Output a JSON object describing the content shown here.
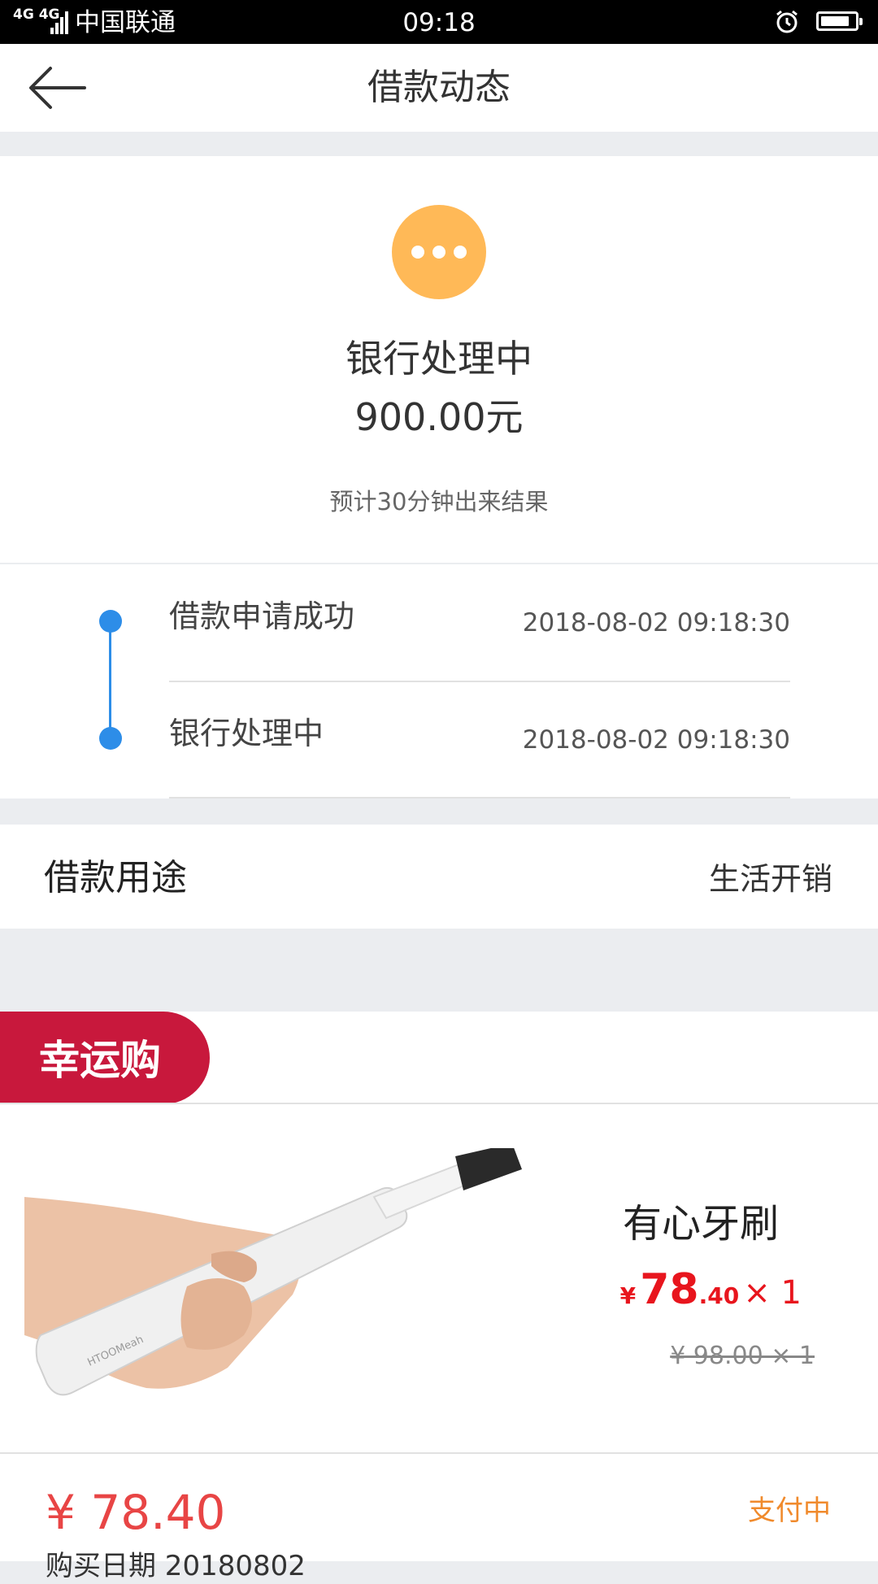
{
  "status_bar": {
    "network": "4G 4G",
    "carrier": "中国联通",
    "time": "09:18",
    "battery_level": 0.85
  },
  "nav": {
    "title": "借款动态"
  },
  "status": {
    "state": "银行处理中",
    "amount": "900.00元",
    "eta": "预计30分钟出来结果",
    "icon_color": "#ffb957"
  },
  "timeline": [
    {
      "label": "借款申请成功",
      "time": "2018-08-02 09:18:30"
    },
    {
      "label": "银行处理中",
      "time": "2018-08-02 09:18:30"
    }
  ],
  "purpose": {
    "label": "借款用途",
    "value": "生活开销"
  },
  "promo": {
    "badge": "幸运购",
    "badge_color": "#c8183c",
    "product": {
      "name": "有心牙刷",
      "brand_on_product": "HTOOMeah",
      "price_symbol": "¥",
      "price_int": "78",
      "price_dec": ".40",
      "qty": "× 1",
      "original": "¥ 98.00 × 1"
    },
    "total": "¥ 78.40",
    "pay_status": "支付中",
    "purchase_date": "购买日期 20180802"
  }
}
